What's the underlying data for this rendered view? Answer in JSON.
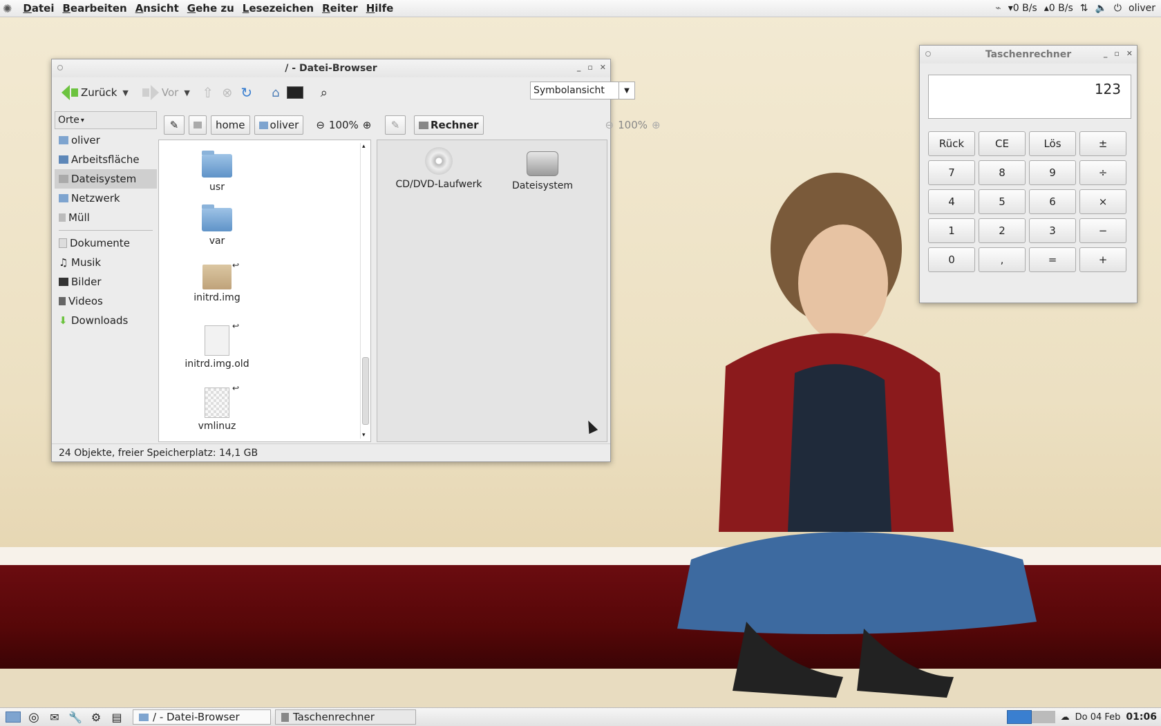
{
  "top_panel": {
    "menu": [
      "Datei",
      "Bearbeiten",
      "Ansicht",
      "Gehe zu",
      "Lesezeichen",
      "Reiter",
      "Hilfe"
    ],
    "net_down": "0 B/s",
    "net_up": "0 B/s",
    "user": "oliver"
  },
  "file_browser": {
    "title": "/ - Datei-Browser",
    "toolbar": {
      "back_label": "Zurück",
      "forward_label": "Vor",
      "view_mode": "Symbolansicht"
    },
    "sidebar": {
      "header": "Orte",
      "places": [
        "oliver",
        "Arbeitsfläche",
        "Dateisystem",
        "Netzwerk",
        "Müll"
      ],
      "bookmarks": [
        "Dokumente",
        "Musik",
        "Bilder",
        "Videos",
        "Downloads"
      ],
      "selected": "Dateisystem"
    },
    "left_pane": {
      "path": [
        "home",
        "oliver"
      ],
      "zoom": "100%",
      "files": [
        "usr",
        "var",
        "initrd.img",
        "initrd.img.old",
        "vmlinuz"
      ]
    },
    "right_pane": {
      "path": [
        "Rechner"
      ],
      "zoom": "100%",
      "files": [
        "CD/DVD-Laufwerk",
        "Dateisystem"
      ]
    },
    "status": "24 Objekte, freier Speicherplatz: 14,1 GB"
  },
  "calculator": {
    "title": "Taschenrechner",
    "display": "123",
    "buttons": [
      "Rück",
      "CE",
      "Lös",
      "±",
      "7",
      "8",
      "9",
      "÷",
      "4",
      "5",
      "6",
      "×",
      "1",
      "2",
      "3",
      "−",
      "0",
      ",",
      "=",
      "+"
    ]
  },
  "taskbar": {
    "tasks": [
      "/ - Datei-Browser",
      "Taschenrechner"
    ],
    "date": "Do 04 Feb",
    "time": "01:06"
  }
}
